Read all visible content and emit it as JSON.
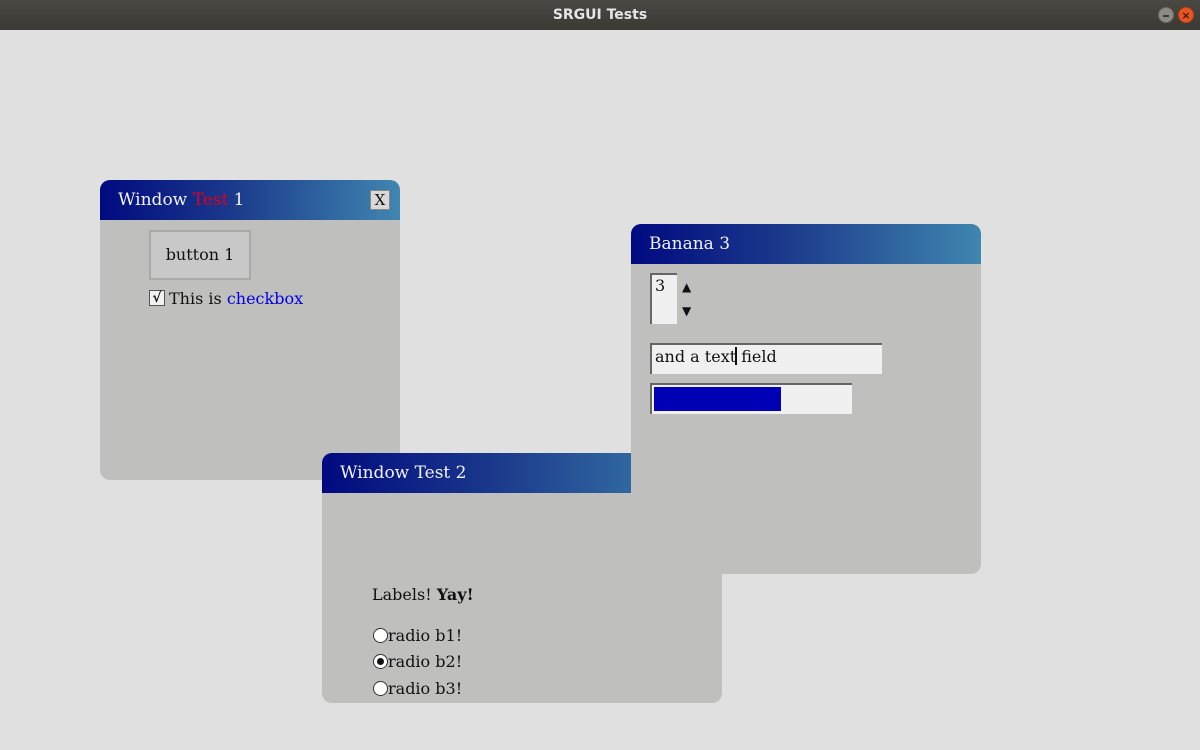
{
  "app": {
    "title": "SRGUI Tests"
  },
  "os_buttons": {
    "close_glyph": "×"
  },
  "window1": {
    "title_a": "Window ",
    "title_b": "Test",
    "title_c": " 1",
    "close_label": "X",
    "button_label": "button 1",
    "checkbox": {
      "checked": true,
      "mark": "√",
      "text_a": "This is ",
      "text_b": "checkbox"
    }
  },
  "window2": {
    "title": "Window Test 2",
    "label_a": "Labels! ",
    "label_b": "Yay!",
    "radios": [
      {
        "label": "radio b1!",
        "selected": false
      },
      {
        "label": "radio b2!",
        "selected": true
      },
      {
        "label": "radio b3!",
        "selected": false
      }
    ]
  },
  "window3": {
    "title": "Banana 3",
    "spinner_value": "3",
    "spin_up": "▲",
    "spin_down": "▼",
    "text_field_before_caret": "and a text",
    "text_field_after_caret": " field",
    "progress_fraction": 0.65
  },
  "colors": {
    "title_red": "#e0001b",
    "link_blue": "#0000e6",
    "progress_fill": "#0000b4",
    "window_bg": "#bfbfbe",
    "desktop_bg": "#e0e0e0"
  }
}
